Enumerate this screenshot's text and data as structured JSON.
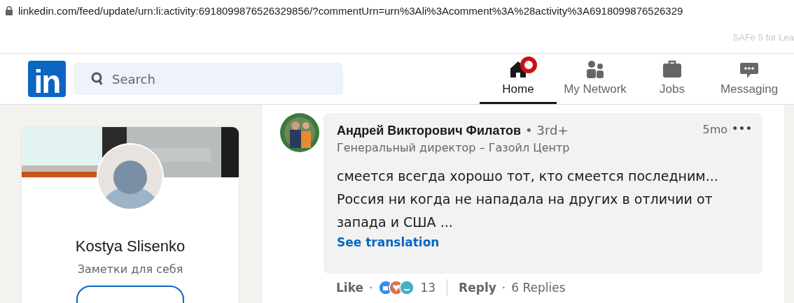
{
  "browser": {
    "url": "linkedin.com/feed/update/urn:li:activity:6918099876526329856/?commentUrn=urn%3Ali%3Acomment%3A%28activity%3A6918099876526329",
    "bookmark": "SAFe 5 for Lea"
  },
  "nav": {
    "logo": "in",
    "search": {
      "placeholder": "Search"
    },
    "tabs": [
      {
        "kind": "home",
        "label": "Home",
        "selected": true,
        "badge": true
      },
      {
        "kind": "network",
        "label": "My Network",
        "selected": false,
        "badge": false
      },
      {
        "kind": "jobs",
        "label": "Jobs",
        "selected": false,
        "badge": false
      },
      {
        "kind": "messaging",
        "label": "Messaging",
        "selected": false,
        "badge": false
      }
    ]
  },
  "profile_card": {
    "name": "Kostya Slisenko",
    "headline": "Заметки для себя"
  },
  "comment": {
    "author": "Андрей Викторович Филатов",
    "degree": "• 3rd+",
    "headline": "Генеральный директор – Газойл Центр",
    "time": "5mo",
    "menu": "•••",
    "text": "смеется всегда хорошо тот, кто смеется последним...\nРоссия ни когда не нападала на других в отличии от\nзапада и США ...",
    "see_translation": "See translation",
    "actions": {
      "like": "Like",
      "sep1": "·",
      "reaction_count": "13",
      "reply": "Reply",
      "sep2": "·",
      "replies": "6 Replies"
    }
  }
}
